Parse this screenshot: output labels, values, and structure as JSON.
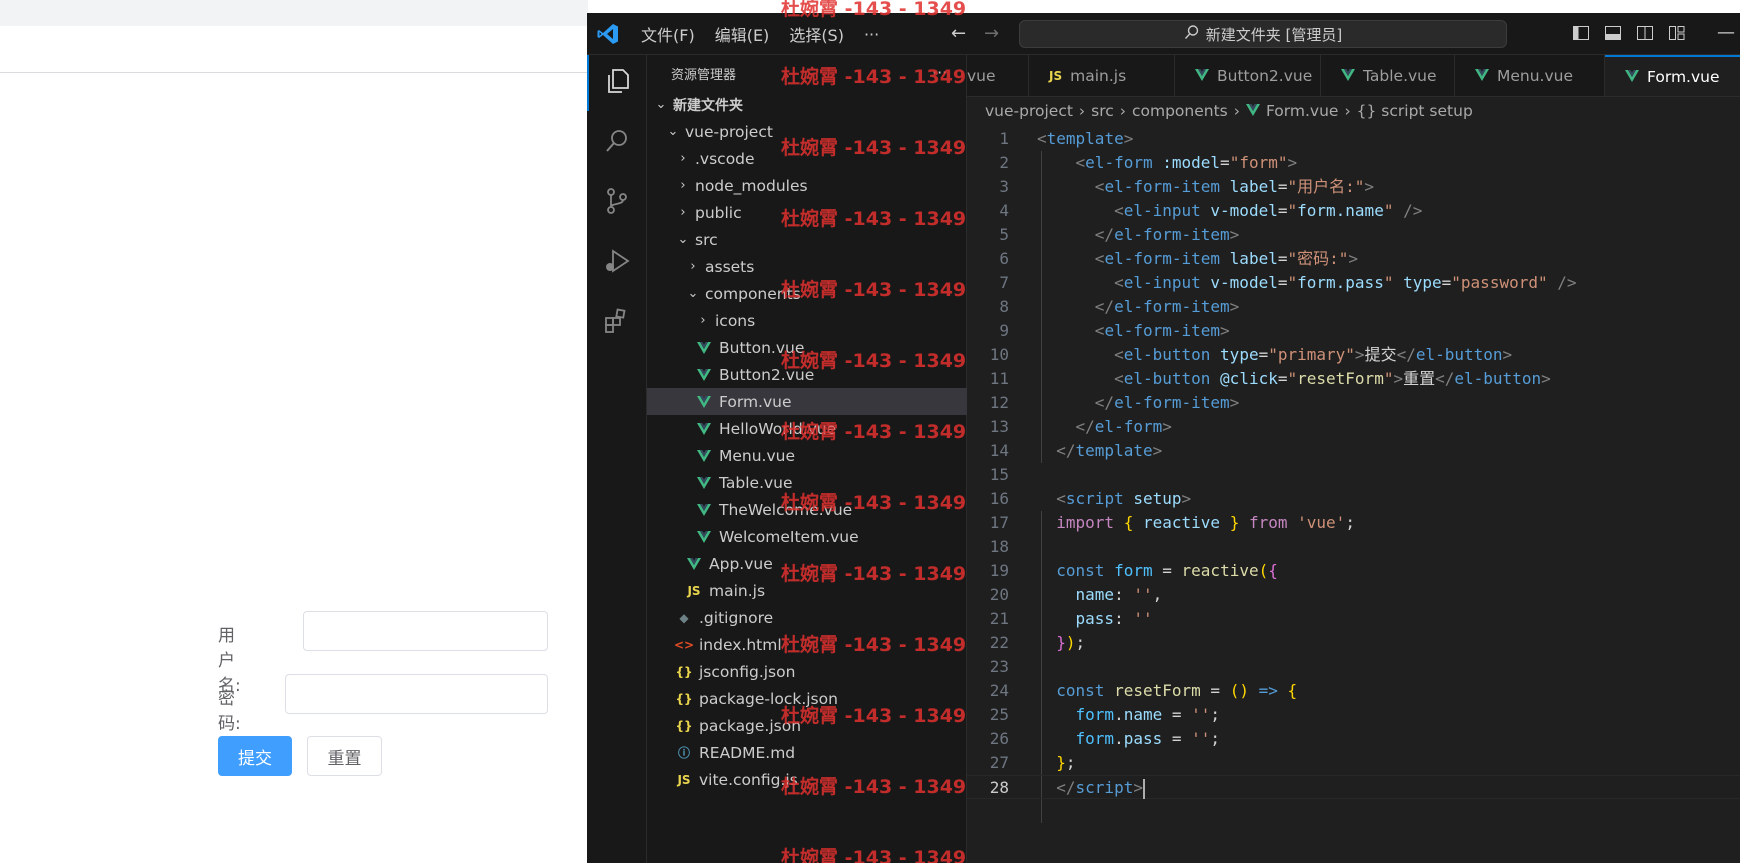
{
  "browser": {
    "form": {
      "username_label": "用户名:",
      "password_label": "密码:",
      "submit_label": "提交",
      "reset_label": "重置",
      "username_value": "",
      "password_value": ""
    }
  },
  "vscode": {
    "menu": [
      "文件(F)",
      "编辑(E)",
      "选择(S)",
      "···"
    ],
    "command_center": "新建文件夹 [管理员]",
    "explorer_title": "资源管理器",
    "explorer_more": "···",
    "tree": [
      {
        "label": "新建文件夹",
        "type": "root"
      },
      {
        "label": "vue-project",
        "type": "folder-open"
      },
      {
        "label": ".vscode",
        "type": "folder"
      },
      {
        "label": "node_modules",
        "type": "folder"
      },
      {
        "label": "public",
        "type": "folder"
      },
      {
        "label": "src",
        "type": "folder-open"
      },
      {
        "label": "assets",
        "type": "folder"
      },
      {
        "label": "components",
        "type": "folder-open"
      },
      {
        "label": "icons",
        "type": "folder"
      },
      {
        "label": "Button.vue",
        "type": "vue"
      },
      {
        "label": "Button2.vue",
        "type": "vue"
      },
      {
        "label": "Form.vue",
        "type": "vue",
        "selected": true
      },
      {
        "label": "HelloWorld.vue",
        "type": "vue"
      },
      {
        "label": "Menu.vue",
        "type": "vue"
      },
      {
        "label": "Table.vue",
        "type": "vue"
      },
      {
        "label": "TheWelcome.vue",
        "type": "vue"
      },
      {
        "label": "WelcomeItem.vue",
        "type": "vue"
      },
      {
        "label": "App.vue",
        "type": "vue"
      },
      {
        "label": "main.js",
        "type": "js"
      },
      {
        "label": ".gitignore",
        "type": "git"
      },
      {
        "label": "index.html",
        "type": "html"
      },
      {
        "label": "jsconfig.json",
        "type": "json"
      },
      {
        "label": "package-lock.json",
        "type": "json"
      },
      {
        "label": "package.json",
        "type": "json"
      },
      {
        "label": "README.md",
        "type": "info"
      },
      {
        "label": "vite.config.js",
        "type": "js"
      }
    ],
    "tabs": [
      {
        "label": "vue",
        "icon": ""
      },
      {
        "label": "main.js",
        "icon": "JS"
      },
      {
        "label": "Button2.vue",
        "icon": "vue"
      },
      {
        "label": "Table.vue",
        "icon": "vue"
      },
      {
        "label": "Menu.vue",
        "icon": "vue"
      },
      {
        "label": "Form.vue",
        "icon": "vue",
        "active": true
      }
    ],
    "breadcrumb": [
      "vue-project",
      "src",
      "components",
      "Form.vue",
      "{} script setup"
    ],
    "code_lines": [
      "1",
      "2",
      "3",
      "4",
      "5",
      "6",
      "7",
      "8",
      "9",
      "10",
      "11",
      "12",
      "13",
      "14",
      "15",
      "16",
      "17",
      "18",
      "19",
      "20",
      "21",
      "22",
      "23",
      "24",
      "25",
      "26",
      "27",
      "28"
    ]
  },
  "watermark": "杜婉霄 -143 - 1349",
  "colors": {
    "primary": "#409eff",
    "vscode_bg": "#1f1f1f",
    "accent": "#0078d4",
    "vue_green": "#41b883"
  }
}
